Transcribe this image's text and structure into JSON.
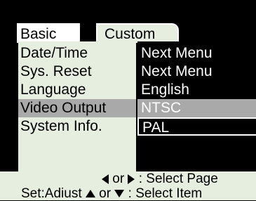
{
  "tabs": [
    {
      "label": "Basic"
    },
    {
      "label": "Custom"
    }
  ],
  "menu": {
    "rows": [
      {
        "label": "Date/Time",
        "value": "Next Menu"
      },
      {
        "label": "Sys. Reset",
        "value": "Next Menu"
      },
      {
        "label": "Language",
        "value": "English"
      },
      {
        "label": "Video Output",
        "value": "NTSC"
      },
      {
        "label": "System Info.",
        "value": "PAL"
      }
    ],
    "selected_index": 3
  },
  "footer": {
    "or_1": "or",
    "select_page": ": Select Page",
    "set_adjust": "Set:Adiust",
    "or_2": "or",
    "select_item": ": Select Item"
  },
  "icons": {
    "left": "arrow-left-icon",
    "right": "arrow-right-icon",
    "up": "arrow-up-icon",
    "down": "arrow-down-icon"
  },
  "colors": {
    "panel_light": "#e6eee0",
    "highlight": "#a9a9a9",
    "background": "#000000"
  }
}
